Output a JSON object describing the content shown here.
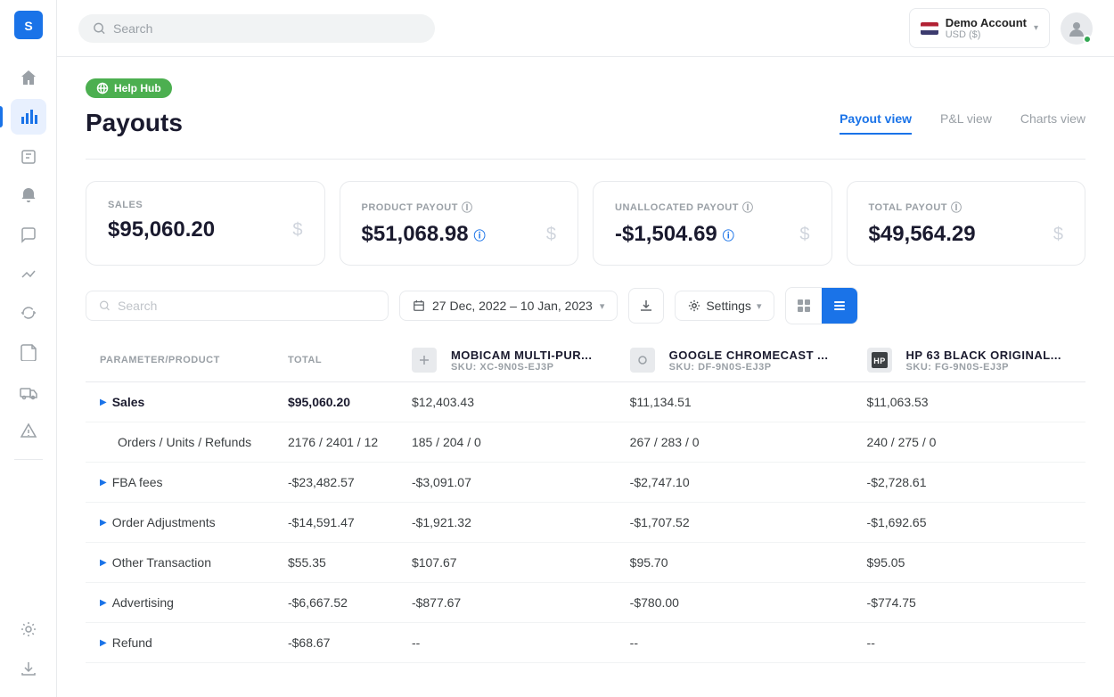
{
  "app": {
    "logo": "SR"
  },
  "sidebar": {
    "items": [
      {
        "id": "home",
        "icon": "⌂",
        "active": false
      },
      {
        "id": "analytics",
        "icon": "▦",
        "active": true
      },
      {
        "id": "orders",
        "icon": "☰",
        "active": false
      },
      {
        "id": "notifications",
        "icon": "🔔",
        "active": false
      },
      {
        "id": "messages",
        "icon": "💬",
        "active": false
      },
      {
        "id": "trends",
        "icon": "↗",
        "active": false
      },
      {
        "id": "sync",
        "icon": "↻",
        "active": false
      },
      {
        "id": "documents",
        "icon": "📄",
        "active": false
      },
      {
        "id": "shipping",
        "icon": "🚚",
        "active": false
      },
      {
        "id": "alerts",
        "icon": "⚠",
        "active": false
      }
    ],
    "bottom_items": [
      {
        "id": "settings",
        "icon": "⚙"
      },
      {
        "id": "export",
        "icon": "→"
      }
    ]
  },
  "topbar": {
    "search_placeholder": "Search",
    "account": {
      "name": "Demo Account",
      "currency": "USD ($)",
      "chevron": "▾"
    }
  },
  "help_hub": {
    "label": "Help Hub"
  },
  "page": {
    "title": "Payouts",
    "tabs": [
      {
        "id": "payout",
        "label": "Payout view",
        "active": true
      },
      {
        "id": "pl",
        "label": "P&L view",
        "active": false
      },
      {
        "id": "charts",
        "label": "Charts view",
        "active": false
      }
    ]
  },
  "kpi": {
    "cards": [
      {
        "id": "sales",
        "label": "SALES",
        "value": "$95,060.20",
        "has_info": false
      },
      {
        "id": "product_payout",
        "label": "PRODUCT PAYOUT",
        "value": "$51,068.98",
        "has_info": true
      },
      {
        "id": "unallocated_payout",
        "label": "UNALLOCATED PAYOUT",
        "value": "-$1,504.69",
        "has_info": true
      },
      {
        "id": "total_payout",
        "label": "TOTAL PAYOUT",
        "value": "$49,564.29",
        "has_info": true
      }
    ]
  },
  "toolbar": {
    "search_placeholder": "Search",
    "date_range": "27 Dec, 2022 – 10 Jan, 2023",
    "settings_label": "Settings",
    "download_title": "Download",
    "view_grid_title": "Grid view",
    "view_list_title": "List view"
  },
  "table": {
    "columns": [
      {
        "id": "parameter",
        "label": "PARAMETER/PRODUCT"
      },
      {
        "id": "total",
        "label": "TOTAL"
      },
      {
        "id": "product1",
        "name": "MobiCam Multi-Pur...",
        "sku": "SKU: XC-9N0S-EJ3P"
      },
      {
        "id": "product2",
        "name": "Google Chromecast ...",
        "sku": "SKU: DF-9N0S-EJ3P"
      },
      {
        "id": "product3",
        "name": "HP 63 Black Original...",
        "sku": "SKU: FG-9N0S-EJ3P"
      }
    ],
    "rows": [
      {
        "id": "sales",
        "label": "Sales",
        "expandable": true,
        "total": "$95,060.20",
        "p1": "$12,403.43",
        "p2": "$11,134.51",
        "p3": "$11,063.53",
        "bold": true
      },
      {
        "id": "orders",
        "label": "Orders / Units / Refunds",
        "expandable": false,
        "total": "2176 / 2401 / 12",
        "p1": "185 / 204 / 0",
        "p2": "267 / 283 / 0",
        "p3": "240 / 275 / 0",
        "bold": false
      },
      {
        "id": "fba",
        "label": "FBA fees",
        "expandable": true,
        "total": "-$23,482.57",
        "p1": "-$3,091.07",
        "p2": "-$2,747.10",
        "p3": "-$2,728.61",
        "bold": false
      },
      {
        "id": "order_adj",
        "label": "Order Adjustments",
        "expandable": true,
        "total": "-$14,591.47",
        "p1": "-$1,921.32",
        "p2": "-$1,707.52",
        "p3": "-$1,692.65",
        "bold": false
      },
      {
        "id": "other_trans",
        "label": "Other Transaction",
        "expandable": true,
        "total": "$55.35",
        "p1": "$107.67",
        "p2": "$95.70",
        "p3": "$95.05",
        "bold": false
      },
      {
        "id": "advertising",
        "label": "Advertising",
        "expandable": true,
        "total": "-$6,667.52",
        "p1": "-$877.67",
        "p2": "-$780.00",
        "p3": "-$774.75",
        "bold": false
      },
      {
        "id": "refund",
        "label": "Refund",
        "expandable": true,
        "total": "-$68.67",
        "p1": "--",
        "p2": "--",
        "p3": "--",
        "bold": false
      }
    ]
  }
}
